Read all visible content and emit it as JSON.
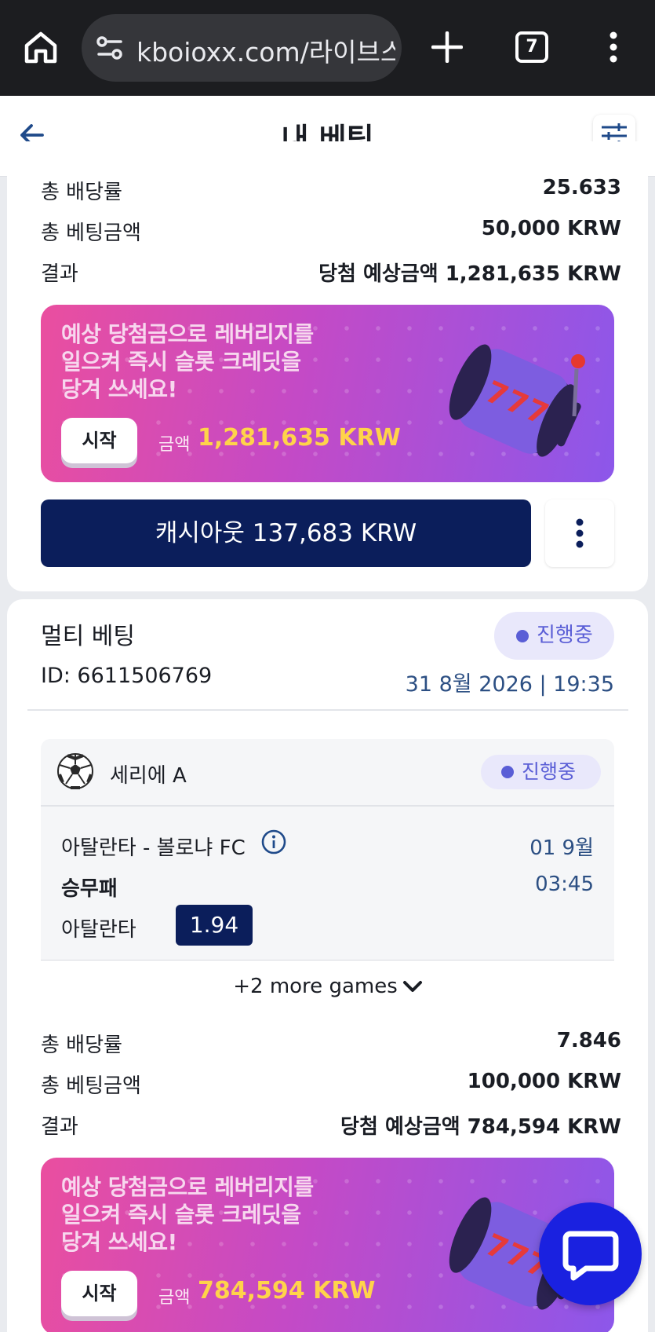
{
  "browser": {
    "url": "kboioxx.com/라이브스",
    "tab_count": "7"
  },
  "header": {
    "title": "내 베팅"
  },
  "bet1": {
    "total_odds_label": "총 배당률",
    "total_odds": "25.633",
    "stake_label": "총 베팅금액",
    "stake": "50,000 KRW",
    "result_label": "결과",
    "result": "당첨 예상금액 1,281,635 KRW",
    "promo": {
      "text": "예상 당첨금으로 레버리지를 일으켜 즉시 슬롯 크레딧을 당겨 쓰세요!",
      "start_label": "시작",
      "amount_label": "금액",
      "amount": "1,281,635 KRW"
    },
    "cashout_label": "캐시아웃 137,683 KRW"
  },
  "bet2": {
    "type": "멀티 베팅",
    "status": "진행중",
    "id": "ID: 6611506769",
    "date": "31 8월 2026 | 19:35",
    "game": {
      "league": "세리에 A",
      "status": "진행중",
      "match": "아탈란타 - 볼로냐 FC",
      "match_date": "01 9월",
      "market": "승무패",
      "time": "03:45",
      "pick": "아탈란타",
      "odds": "1.94"
    },
    "more_games": "+2 more games",
    "total_odds_label": "총 배당률",
    "total_odds": "7.846",
    "stake_label": "총 베팅금액",
    "stake": "100,000 KRW",
    "result_label": "결과",
    "result": "당첨 예상금액 784,594 KRW",
    "promo": {
      "text": "예상 당첨금으로 레버리지를 일으켜 즉시 슬롯 크레딧을 당겨 쓰세요!",
      "start_label": "시작",
      "amount_label": "금액",
      "amount": "784,594 KRW"
    }
  },
  "colors": {
    "navy": "#0b1e5b",
    "status": "#5a5ed6",
    "amount": "#ffd34a",
    "chat": "#1a21e0"
  }
}
